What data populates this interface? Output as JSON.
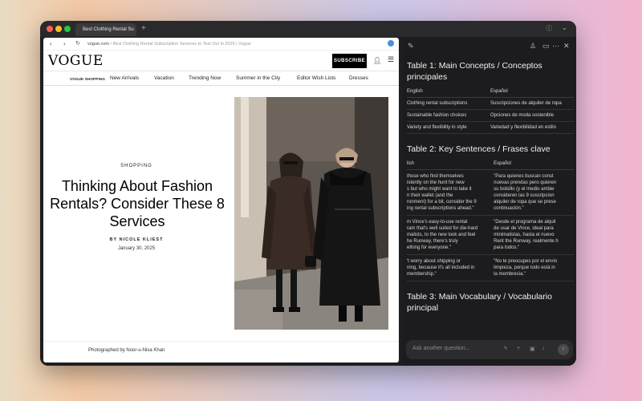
{
  "browser": {
    "tab_title": "Best Clothing Rental Su",
    "new_tab": "+",
    "icons": {
      "back": "arrow-left",
      "forward": "arrow-right",
      "reload": "reload",
      "new_tab": "plus",
      "info": "info",
      "dropdown": "chevron-down"
    }
  },
  "address": {
    "domain": "vogue.com",
    "path": "/ Best Clothing Rental Subscription Services to Test Out in 2025 | Vogue"
  },
  "vogue": {
    "logo": "VOGUE",
    "subscribe": "SUBSCRIBE",
    "subnav": [
      "VOGUE SHOPPING",
      "New Arrivals",
      "Vacation",
      "Trending Now",
      "Summer in the City",
      "Editor Wish Lists",
      "Dresses"
    ]
  },
  "article": {
    "kicker": "SHOPPING",
    "headline": "Thinking About Fashion Rentals? Consider These 8 Services",
    "byline": "BY NICOLE KLIEST",
    "date": "January 30, 2025",
    "credit": "Photographed by Noor-u-Nisa Khan"
  },
  "sidebar": {
    "table1": {
      "title": "Table 1: Main Concepts / Conceptos principales",
      "headers": [
        "English",
        "Español"
      ],
      "rows": [
        [
          "Clothing rental subscriptions",
          "Suscripciones de alquiler de ropa"
        ],
        [
          "Sustainable fashion choices",
          "Opciones de moda sostenible"
        ],
        [
          "Variety and flexibility in style",
          "Variedad y flexibilidad en estilo"
        ]
      ]
    },
    "table2": {
      "title": "Table 2: Key Sentences / Frases clave",
      "headers": [
        "lish",
        "Español"
      ],
      "rows": [
        [
          "those who find themselves\nistently on the hunt for new\ns but who might want to take it\nn their wallet (and the\nronment) for a bit, consider the 9\ning rental subscriptions ahead.\"",
          "\"Para quienes buscan const\nnuevas prendas pero quieren\nsu bolsillo (y el medio ambie\nconsideren las 9 suscripcion\nalquiler de ropa que se prese\ncontinuación.\""
        ],
        [
          "m Vince's easy-to-use rental\nram that's well suited for die-hard\nmalists, to the new look and feel\nhe Runway, there's truly\nething for everyone.\"",
          "\"Desde el programa de alquil\nde usar de Vince, ideal para\nminimalistas, hasta el nuevo\nRent the Runway, realmente h\npara todos.\""
        ],
        [
          "'t worry about shipping or\nning, because it's all included in\nmembership.\"",
          "\"No te preocupes por el envío\nlimpieza, porque todo está in\nla membresía.\""
        ]
      ]
    },
    "table3": {
      "title": "Table 3: Main Vocabulary / Vocabulario principal"
    },
    "ask_placeholder": "Ask another question..."
  }
}
